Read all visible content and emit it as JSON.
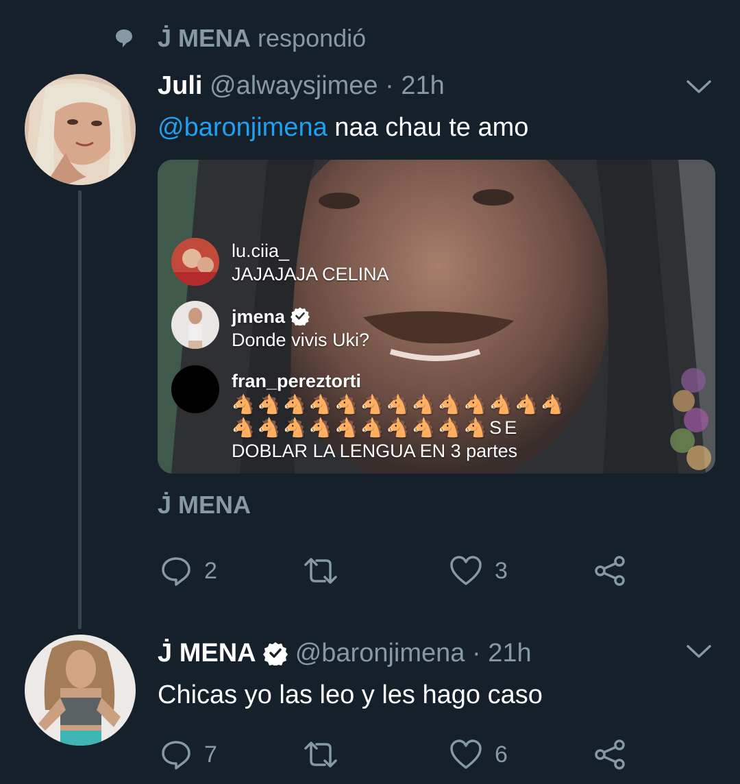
{
  "social_context": {
    "icon": "speech-bubble-icon",
    "name": "J̇ MENA",
    "action": "respondió"
  },
  "tweet1": {
    "display_name": "Juli",
    "handle": "@alwaysjimee",
    "time": "· 21h",
    "mention": "@baronjimena",
    "text": " naa chau te amo",
    "media_comments": [
      {
        "user": "lu.ciia_",
        "text": "JAJAJAJA CELINA"
      },
      {
        "user": "jmena",
        "text": "Donde vivis Uki?"
      },
      {
        "user": "fran_pereztorti",
        "line1": "🐴🐴🐴🐴🐴🐴🐴🐴🐴🐴🐴🐴🐴",
        "line2": "🐴🐴🐴🐴🐴🐴🐴🐴🐴🐴SE",
        "line3": "DOBLAR LA LENGUA EN 3 partes"
      }
    ],
    "media_author": "J̇ MENA",
    "replies": "2",
    "retweets": "",
    "likes": "3"
  },
  "tweet2": {
    "display_name": "J̇ MENA",
    "handle": "@baronjimena",
    "time": "· 21h",
    "text": "Chicas yo las leo y les hago caso",
    "replies": "7",
    "retweets": "",
    "likes": "6"
  },
  "colors": {
    "background": "#15202b",
    "muted": "#8899a6",
    "link": "#1da1f2",
    "thread_line": "#38444d"
  }
}
